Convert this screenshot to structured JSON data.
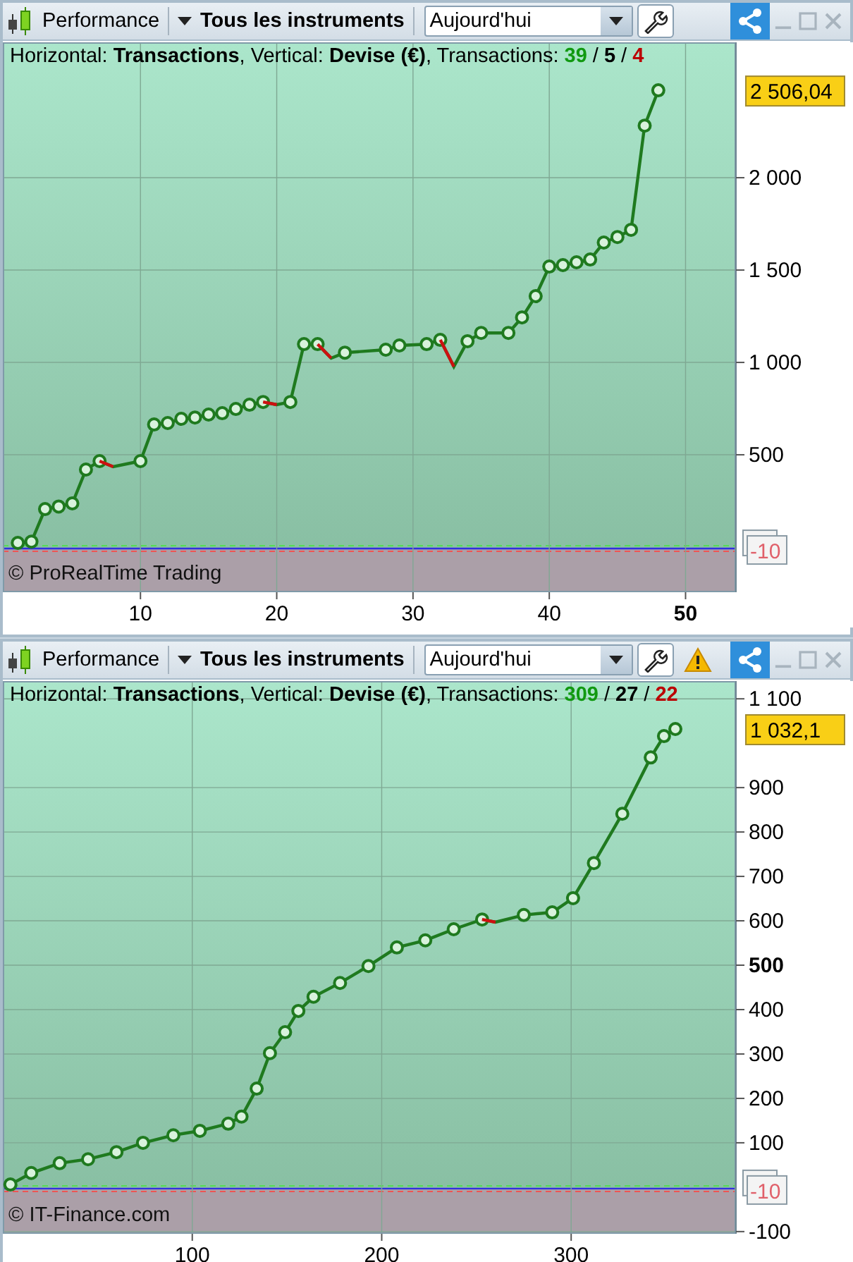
{
  "panels": [
    {
      "toolbar": {
        "tab_label": "Performance",
        "filter": "Tous les instruments",
        "period": "Aujourd'hui",
        "warning": false
      },
      "legend": {
        "text": "Horizontal: **Transactions**, Vertical: **Devise (€)**, Transactions:",
        "separator": "/",
        "counts": [
          {
            "value": "39",
            "color": "#119911"
          },
          {
            "value": "5",
            "color": "#000000"
          },
          {
            "value": "4",
            "color": "#bb0000"
          }
        ]
      },
      "copyright": "© ProRealTime Trading",
      "last_value_label": "2 506,04",
      "reference_label": "-10",
      "x_tick_bold": [
        false,
        false,
        false,
        false,
        true
      ],
      "y_tick_bold": [
        false,
        false,
        false,
        false
      ],
      "chart_data": {
        "type": "line",
        "grid": true,
        "x": [
          1,
          2,
          3,
          4,
          5,
          6,
          7,
          8,
          10,
          11,
          12,
          13,
          14,
          15,
          16,
          17,
          18,
          19,
          20,
          21,
          22,
          23,
          24,
          25,
          28,
          29,
          31,
          32,
          33,
          34,
          35,
          37,
          38,
          39,
          40,
          41,
          42,
          43,
          44,
          45,
          46,
          47,
          48
        ],
        "series": [
          {
            "color": "#1f7a1f",
            "marker": "o",
            "values": [
              23,
              30,
              206,
              220,
              237,
              420,
              466,
              435,
              466,
              664,
              672,
              695,
              702,
              718,
              725,
              748,
              771,
              786,
              771,
              786,
              1099,
              1099,
              1023,
              1053,
              1069,
              1092,
              1099,
              1122,
              977,
              1115,
              1160,
              1160,
              1244,
              1359,
              1519,
              1527,
              1542,
              1557,
              1649,
              1679,
              1718,
              2282,
              2473
            ]
          },
          {
            "color": "#cc1111",
            "values": [
              null,
              null,
              null,
              null,
              null,
              null,
              466,
              435,
              null,
              null,
              null,
              null,
              null,
              null,
              null,
              null,
              null,
              786,
              771,
              null,
              null,
              1099,
              1023,
              null,
              null,
              null,
              null,
              1122,
              977,
              null,
              null,
              null,
              null,
              null,
              null,
              null,
              null,
              null,
              null,
              null,
              null,
              null,
              null
            ]
          }
        ],
        "xlim": [
          -0.1,
          53.7
        ],
        "ylim": [
          -244,
          2733
        ],
        "xticks": [
          10,
          20,
          30,
          40,
          50
        ],
        "yticks": [
          {
            "value": 500,
            "label": "500"
          },
          {
            "value": 1000,
            "label": "1 000"
          },
          {
            "value": 1500,
            "label": "1 500"
          },
          {
            "value": 2000,
            "label": "2 000"
          }
        ]
      }
    },
    {
      "toolbar": {
        "tab_label": "Performance",
        "filter": "Tous les instruments",
        "period": "Aujourd'hui",
        "warning": true
      },
      "legend": {
        "text": "Horizontal: **Transactions**, Vertical: **Devise (€)**, Transactions:",
        "separator": "/",
        "counts": [
          {
            "value": "309",
            "color": "#119911"
          },
          {
            "value": "27",
            "color": "#000000"
          },
          {
            "value": "22",
            "color": "#bb0000"
          }
        ]
      },
      "copyright": "© IT-Finance.com",
      "last_value_label": "1 032,1",
      "reference_label": "-10",
      "x_tick_bold": [
        false,
        false,
        false
      ],
      "y_tick_bold": [
        false,
        false,
        false,
        false,
        false,
        true,
        false,
        false,
        false,
        false,
        false
      ],
      "chart_data": {
        "type": "line",
        "grid": true,
        "x": [
          4,
          15,
          30,
          45,
          60,
          74,
          90,
          104,
          119,
          126,
          134,
          141,
          149,
          156,
          164,
          178,
          193,
          208,
          223,
          238,
          253,
          260,
          275,
          290,
          301,
          312,
          327,
          342,
          349,
          355
        ],
        "series": [
          {
            "color": "#1f7a1f",
            "marker": "o",
            "values": [
              6,
              32,
              54,
              63,
              79,
              100,
              117,
              127,
              143,
              159,
              222,
              302,
              349,
              397,
              429,
              460,
              498,
              540,
              556,
              581,
              603,
              597,
              613,
              619,
              651,
              730,
              841,
              968,
              1016,
              1032
            ]
          },
          {
            "color": "#cc1111",
            "values": [
              null,
              null,
              null,
              null,
              null,
              null,
              null,
              null,
              null,
              null,
              null,
              null,
              null,
              null,
              null,
              null,
              null,
              null,
              null,
              null,
              603,
              597,
              null,
              null,
              null,
              null,
              null,
              null,
              null,
              null
            ]
          }
        ],
        "xlim": [
          0,
          387
        ],
        "ylim": [
          -105,
          1140
        ],
        "xticks": [
          100,
          200,
          300
        ],
        "yticks": [
          {
            "value": -100,
            "label": "-100"
          },
          {
            "value": 100,
            "label": "100"
          },
          {
            "value": 200,
            "label": "200"
          },
          {
            "value": 300,
            "label": "300"
          },
          {
            "value": 400,
            "label": "400"
          },
          {
            "value": 500,
            "label": "500"
          },
          {
            "value": 600,
            "label": "600"
          },
          {
            "value": 700,
            "label": "700"
          },
          {
            "value": 800,
            "label": "800"
          },
          {
            "value": 900,
            "label": "900"
          },
          {
            "value": 1100,
            "label": "1 100"
          }
        ]
      }
    }
  ]
}
